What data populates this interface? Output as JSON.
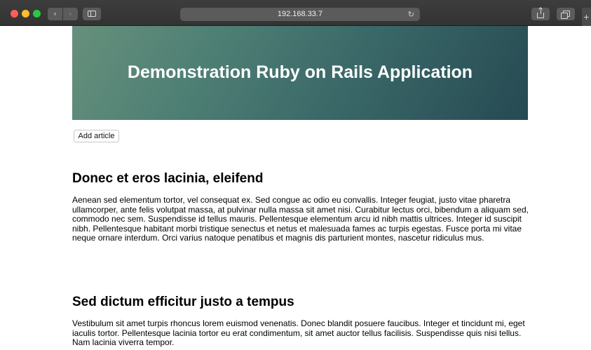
{
  "browser": {
    "url": "192.168.33.7",
    "icons": {
      "back": "chevron-left-icon",
      "forward": "chevron-right-icon",
      "sidebar": "sidebar-icon",
      "reload": "reload-icon",
      "share": "share-icon",
      "tabs": "tabs-icon",
      "new_tab": "plus-icon"
    }
  },
  "hero": {
    "title": "Demonstration Ruby on Rails Application"
  },
  "actions": {
    "add_article": "Add article"
  },
  "articles": [
    {
      "title": "Donec et eros lacinia, eleifend",
      "body": "Aenean sed elementum tortor, vel consequat ex. Sed congue ac odio eu convallis. Integer feugiat, justo vitae pharetra ullamcorper, ante felis volutpat massa, at pulvinar nulla massa sit amet nisi. Curabitur lectus orci, bibendum a aliquam sed, commodo nec sem. Suspendisse id tellus mauris. Pellentesque elementum arcu id nibh mattis ultrices. Integer id suscipit nibh. Pellentesque habitant morbi tristique senectus et netus et malesuada fames ac turpis egestas. Fusce porta mi vitae neque ornare interdum. Orci varius natoque penatibus et magnis dis parturient montes, nascetur ridiculus mus."
    },
    {
      "title": "Sed dictum efficitur justo a tempus",
      "body": "Vestibulum sit amet turpis rhoncus lorem euismod venenatis. Donec blandit posuere faucibus. Integer et tincidunt mi, eget iaculis tortor. Pellentesque lacinia tortor eu erat condimentum, sit amet auctor tellus facilisis. Suspendisse quis nisi tellus. Nam lacinia viverra tempor."
    }
  ],
  "colors": {
    "toolbar": "#383838",
    "hero_start": "#66907c",
    "hero_end": "#264a52",
    "hero_text": "#ffffff"
  }
}
